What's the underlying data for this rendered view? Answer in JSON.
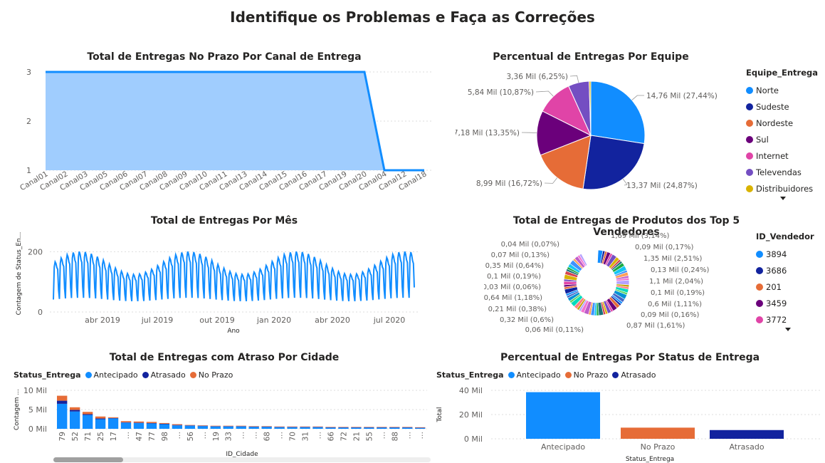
{
  "page_title": "Identifique os Problemas e Faça as Correções",
  "colors": {
    "norte": "#118DFF",
    "sudeste": "#12239E",
    "nordeste": "#E66C37",
    "sul": "#6B007B",
    "internet": "#E044A7",
    "televendas": "#744EC2",
    "distribuidores": "#D9B300",
    "area_fill": "#A0CDFE",
    "line": "#118DFF"
  },
  "chart_data": [
    {
      "id": "canal",
      "type": "area",
      "title": "Total de Entregas No Prazo Por Canal de Entrega",
      "categories": [
        "Canal01",
        "Canal02",
        "Canal03",
        "Canal05",
        "Canal06",
        "Canal07",
        "Canal08",
        "Canal09",
        "Canal10",
        "Canal11",
        "Canal13",
        "Canal14",
        "Canal15",
        "Canal16",
        "Canal17",
        "Canal19",
        "Canal20",
        "Canal04",
        "Canal12",
        "Canal18"
      ],
      "values": [
        3,
        3,
        3,
        3,
        3,
        3,
        3,
        3,
        3,
        3,
        3,
        3,
        3,
        3,
        3,
        3,
        3,
        1,
        1,
        1
      ],
      "yticks": [
        1,
        2,
        3
      ],
      "ylim": [
        1,
        3
      ]
    },
    {
      "id": "equipe",
      "type": "pie",
      "title": "Percentual de Entregas Por Equipe",
      "legend_title": "Equipe_Entrega",
      "slices": [
        {
          "name": "Norte",
          "label": "14,76 Mil (27,44%)",
          "pct": 27.44,
          "color": "#118DFF"
        },
        {
          "name": "Sudeste",
          "label": "13,37 Mil (24,87%)",
          "pct": 24.87,
          "color": "#12239E"
        },
        {
          "name": "Nordeste",
          "label": "8,99 Mil (16,72%)",
          "pct": 16.72,
          "color": "#E66C37"
        },
        {
          "name": "Sul",
          "label": "7,18 Mil (13,35%)",
          "pct": 13.35,
          "color": "#6B007B"
        },
        {
          "name": "Internet",
          "label": "5,84 Mil (10,87%)",
          "pct": 10.87,
          "color": "#E044A7"
        },
        {
          "name": "Televendas",
          "label": "3,36 Mil (6,25%)",
          "pct": 6.25,
          "color": "#744EC2"
        },
        {
          "name": "Distribuidores",
          "label": "",
          "pct": 0.5,
          "color": "#D9B300"
        }
      ]
    },
    {
      "id": "mes",
      "type": "line",
      "title": "Total de Entregas Por Mês",
      "xlabel": "Ano",
      "ylabel": "Contagem de Status_En...",
      "yticks": [
        0,
        200
      ],
      "ylim": [
        0,
        260
      ],
      "xticks": [
        "abr 2019",
        "jul 2019",
        "out 2019",
        "jan 2020",
        "abr 2020",
        "jul 2020"
      ]
    },
    {
      "id": "vendedores",
      "type": "pie",
      "title": "Total de Entregas de Produtos dos Top 5 Vendedores",
      "legend_title": "ID_Vendedor",
      "legend": [
        {
          "name": "3894",
          "color": "#118DFF"
        },
        {
          "name": "3686",
          "color": "#12239E"
        },
        {
          "name": "201",
          "color": "#E66C37"
        },
        {
          "name": "3459",
          "color": "#6B007B"
        },
        {
          "name": "3772",
          "color": "#E044A7"
        }
      ],
      "labels_right": [
        "1,69 Mil (3,14%)",
        "0,09 Mil (0,17%)",
        "1,35 Mil (2,51%)",
        "0,13 Mil (0,24%)",
        "1,1 Mil (2,04%)",
        "0,1 Mil (0,19%)",
        "0,6 Mil (1,11%)",
        "0,09 Mil (0,16%)",
        "0,87 Mil (1,61%)"
      ],
      "labels_left": [
        "0,04 Mil (0,07%)",
        "0,07 Mil (0,13%)",
        "0,35 Mil (0,64%)",
        "0,1 Mil (0,19%)",
        "0,03 Mil (0,06%)",
        "0,64 Mil (1,18%)",
        "0,21 Mil (0,38%)",
        "0,32 Mil (0,6%)",
        "0,06 Mil (0,11%)"
      ]
    },
    {
      "id": "cidade",
      "type": "bar",
      "title": "Total de Entregas com Atraso Por Cidade",
      "legend_title": "Status_Entrega",
      "series": [
        {
          "name": "Antecipado",
          "color": "#118DFF",
          "values": [
            6.5,
            4.5,
            3.6,
            2.5,
            2.7,
            1.6,
            1.5,
            1.4,
            1.2,
            0.9,
            0.8,
            0.7,
            0.6,
            0.6,
            0.6,
            0.5,
            0.5,
            0.4,
            0.4,
            0.4,
            0.4,
            0.3,
            0.3,
            0.3,
            0.3,
            0.3,
            0.3,
            0.3,
            0.2
          ]
        },
        {
          "name": "Atrasado",
          "color": "#12239E",
          "values": [
            0.8,
            0.4,
            0.2,
            0.2,
            0.1,
            0.1,
            0.1,
            0.1,
            0.1,
            0.1,
            0.1,
            0.1,
            0.1,
            0.1,
            0.1,
            0.1,
            0.1,
            0.1,
            0.1,
            0.1,
            0.1,
            0.1,
            0.1,
            0.1,
            0.1,
            0.1,
            0.1,
            0.1,
            0.1
          ]
        },
        {
          "name": "No Prazo",
          "color": "#E66C37",
          "values": [
            1.3,
            0.7,
            0.6,
            0.5,
            0.2,
            0.3,
            0.3,
            0.3,
            0.2,
            0.2,
            0.1,
            0.1,
            0.1,
            0.1,
            0.1,
            0.1,
            0.1,
            0.1,
            0.1,
            0.1,
            0.1,
            0.1,
            0.1,
            0.1,
            0.1,
            0.1,
            0.1,
            0.1,
            0.1
          ]
        }
      ],
      "categories": [
        "79",
        "52",
        "71",
        "25",
        "17",
        "…",
        "47",
        "77",
        "98",
        "…",
        "56",
        "…",
        "19",
        "33",
        "…",
        "…",
        "68",
        "…",
        "70",
        "31",
        "…",
        "66",
        "72",
        "21",
        "55",
        "…",
        "88",
        "…",
        "…"
      ],
      "xlabel": "ID_Cidade",
      "ylabel": "Contagem ...",
      "yticks": [
        "0 Mil",
        "5 Mil",
        "10 Mil"
      ],
      "ylim": [
        0,
        10
      ]
    },
    {
      "id": "status",
      "type": "bar",
      "title": "Percentual de Entregas Por Status de Entrega",
      "legend_title": "Status_Entrega",
      "legend": [
        {
          "name": "Antecipado",
          "color": "#118DFF"
        },
        {
          "name": "No Prazo",
          "color": "#E66C37"
        },
        {
          "name": "Atrasado",
          "color": "#12239E"
        }
      ],
      "categories": [
        "Antecipado",
        "No Prazo",
        "Atrasado"
      ],
      "values": [
        38.5,
        9.2,
        7.2
      ],
      "colors": [
        "#118DFF",
        "#E66C37",
        "#12239E"
      ],
      "xlabel": "Status_Entrega",
      "ylabel": "Total",
      "yticks": [
        "0 Mil",
        "20 Mil",
        "40 Mil"
      ],
      "ylim": [
        0,
        40
      ]
    }
  ]
}
